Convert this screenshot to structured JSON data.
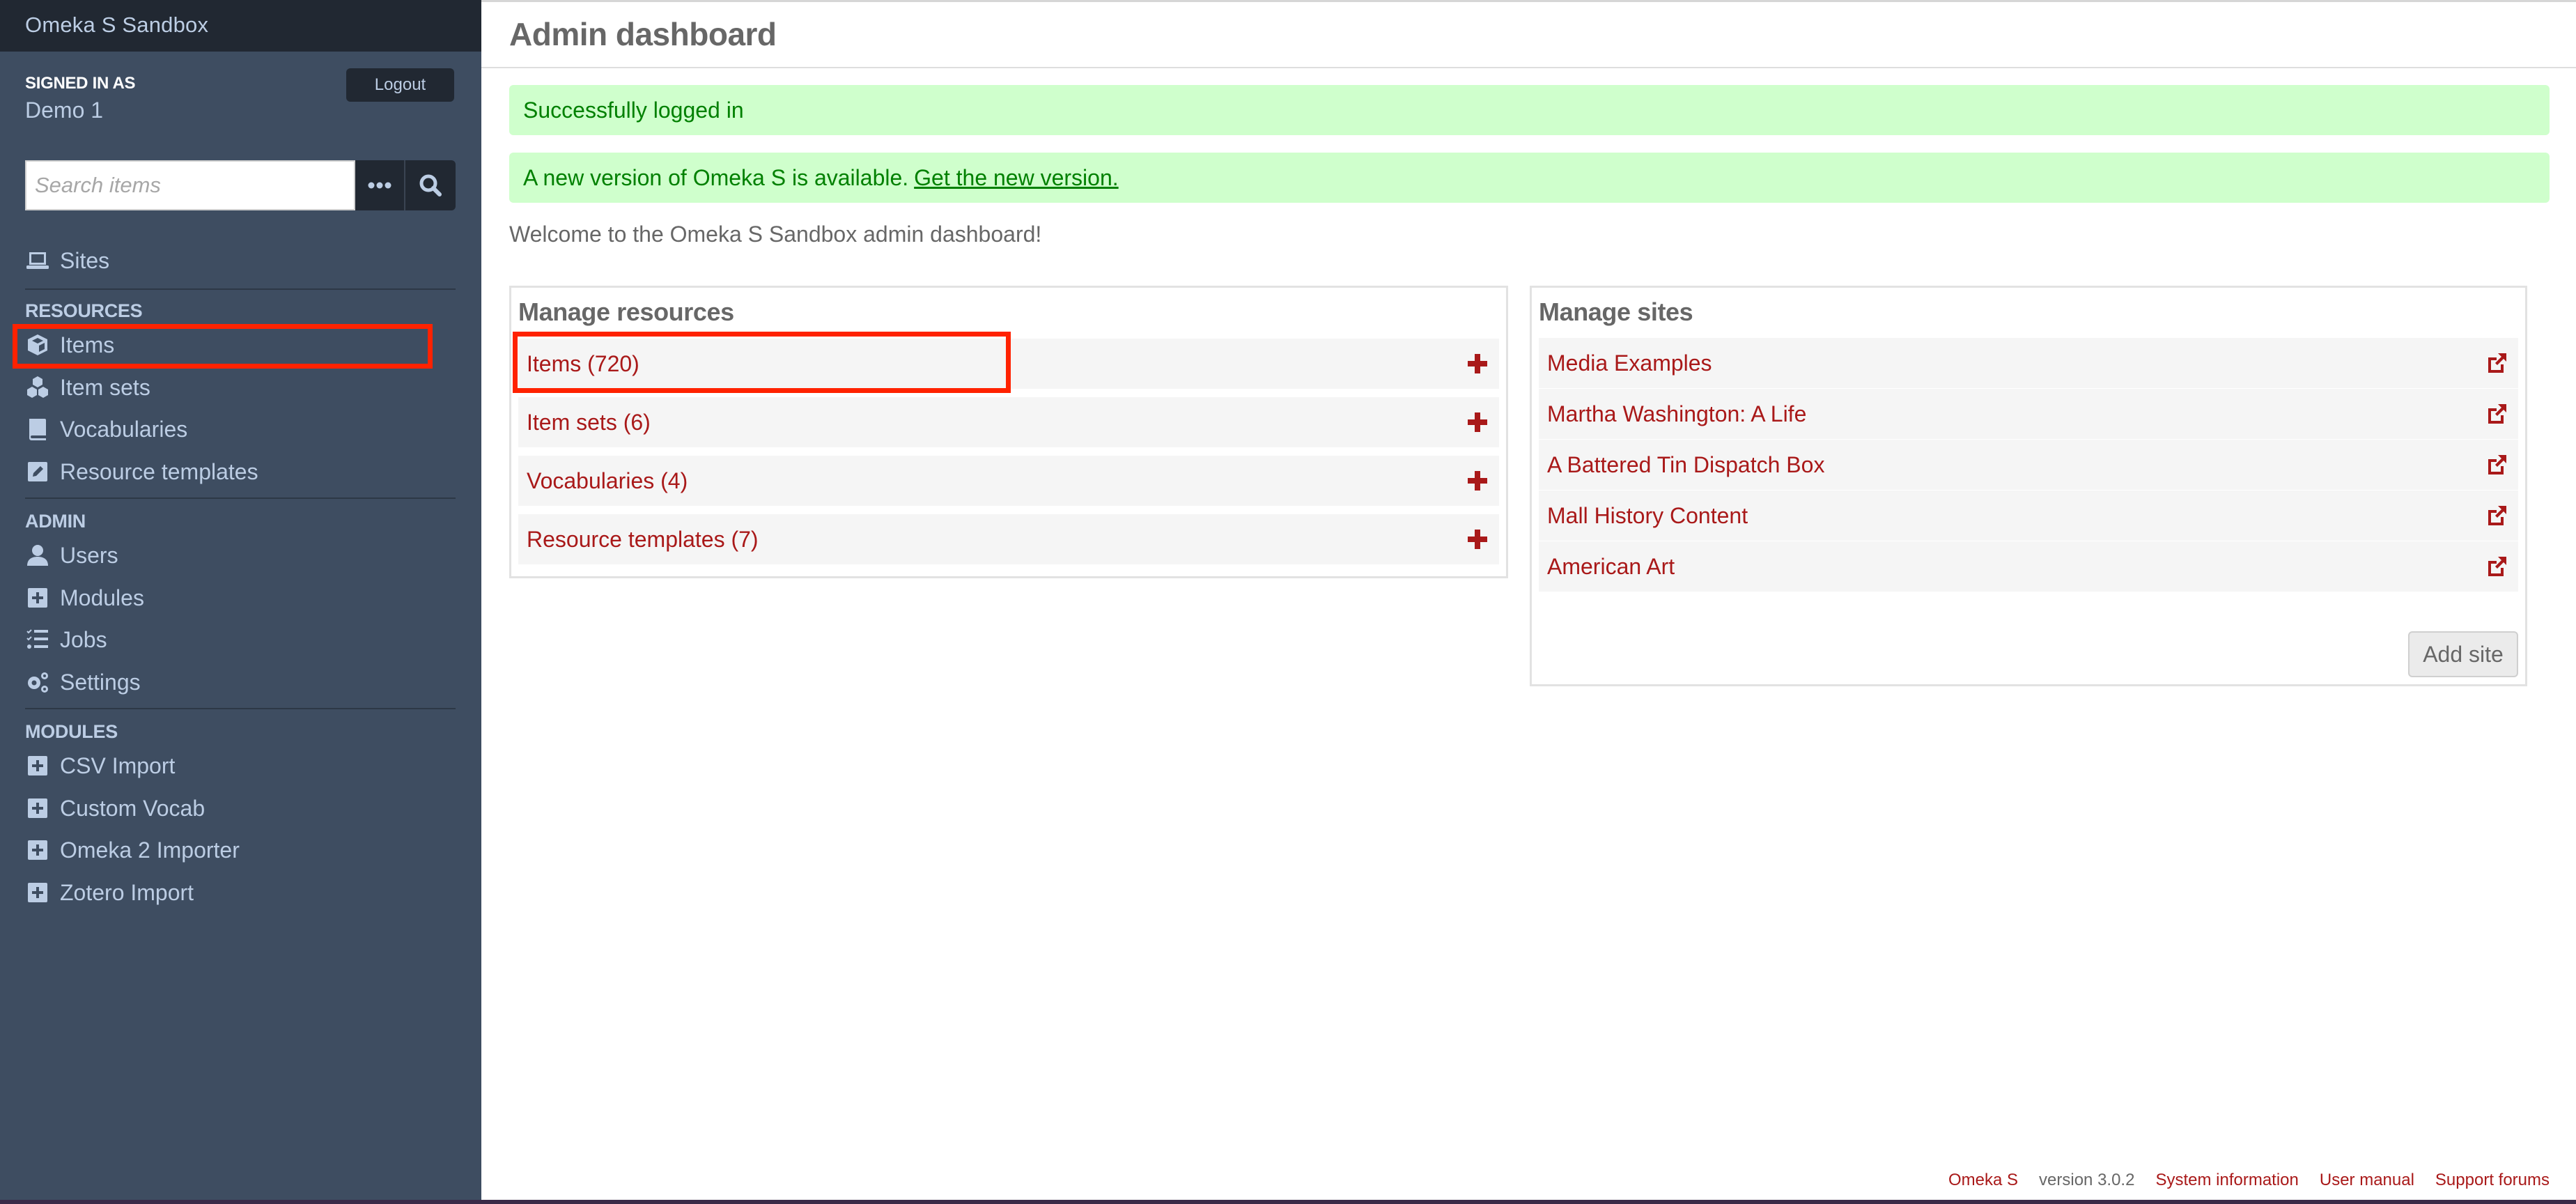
{
  "sidebar": {
    "site_title": "Omeka S Sandbox",
    "signed_in_label": "SIGNED IN AS",
    "user_name": "Demo 1",
    "logout_label": "Logout",
    "search": {
      "placeholder": "Search items",
      "value": ""
    },
    "sites_label": "Sites",
    "sections": {
      "resources": "RESOURCES",
      "admin": "ADMIN",
      "modules": "MODULES"
    },
    "resources": [
      {
        "label": "Items",
        "icon": "cube-icon"
      },
      {
        "label": "Item sets",
        "icon": "cubes-icon"
      },
      {
        "label": "Vocabularies",
        "icon": "book-icon"
      },
      {
        "label": "Resource templates",
        "icon": "edit-icon"
      }
    ],
    "admin": [
      {
        "label": "Users",
        "icon": "user-icon"
      },
      {
        "label": "Modules",
        "icon": "plus-square-icon"
      },
      {
        "label": "Jobs",
        "icon": "tasks-icon"
      },
      {
        "label": "Settings",
        "icon": "cogs-icon"
      }
    ],
    "modules": [
      {
        "label": "CSV Import",
        "icon": "plus-square-icon"
      },
      {
        "label": "Custom Vocab",
        "icon": "plus-square-icon"
      },
      {
        "label": "Omeka 2 Importer",
        "icon": "plus-square-icon"
      },
      {
        "label": "Zotero Import",
        "icon": "plus-square-icon"
      }
    ]
  },
  "main": {
    "page_title": "Admin dashboard",
    "alerts": [
      {
        "text": "Successfully logged in"
      },
      {
        "text": "A new version of Omeka S is available.",
        "link": "Get the new version."
      }
    ],
    "welcome": "Welcome to the Omeka S Sandbox admin dashboard!",
    "manage_resources": {
      "title": "Manage resources",
      "rows": [
        {
          "label": "Items (720)"
        },
        {
          "label": "Item sets (6)"
        },
        {
          "label": "Vocabularies (4)"
        },
        {
          "label": "Resource templates (7)"
        }
      ]
    },
    "manage_sites": {
      "title": "Manage sites",
      "rows": [
        {
          "label": "Media Examples"
        },
        {
          "label": "Martha Washington: A Life"
        },
        {
          "label": "A Battered Tin Dispatch Box"
        },
        {
          "label": "Mall History Content"
        },
        {
          "label": "American Art"
        }
      ],
      "add_site_label": "Add site"
    }
  },
  "footer": {
    "product": "Omeka S",
    "version": "version 3.0.2",
    "links": [
      "System information",
      "User manual",
      "Support forums"
    ]
  },
  "colors": {
    "sidebar_bg": "#3e4d61",
    "sidebar_header_bg": "#212832",
    "sidebar_text": "#bccde4",
    "link": "#a91919",
    "alert_bg": "#cfffcc",
    "alert_text": "#008000",
    "heading": "#676767",
    "annotation": "#ff2200"
  }
}
